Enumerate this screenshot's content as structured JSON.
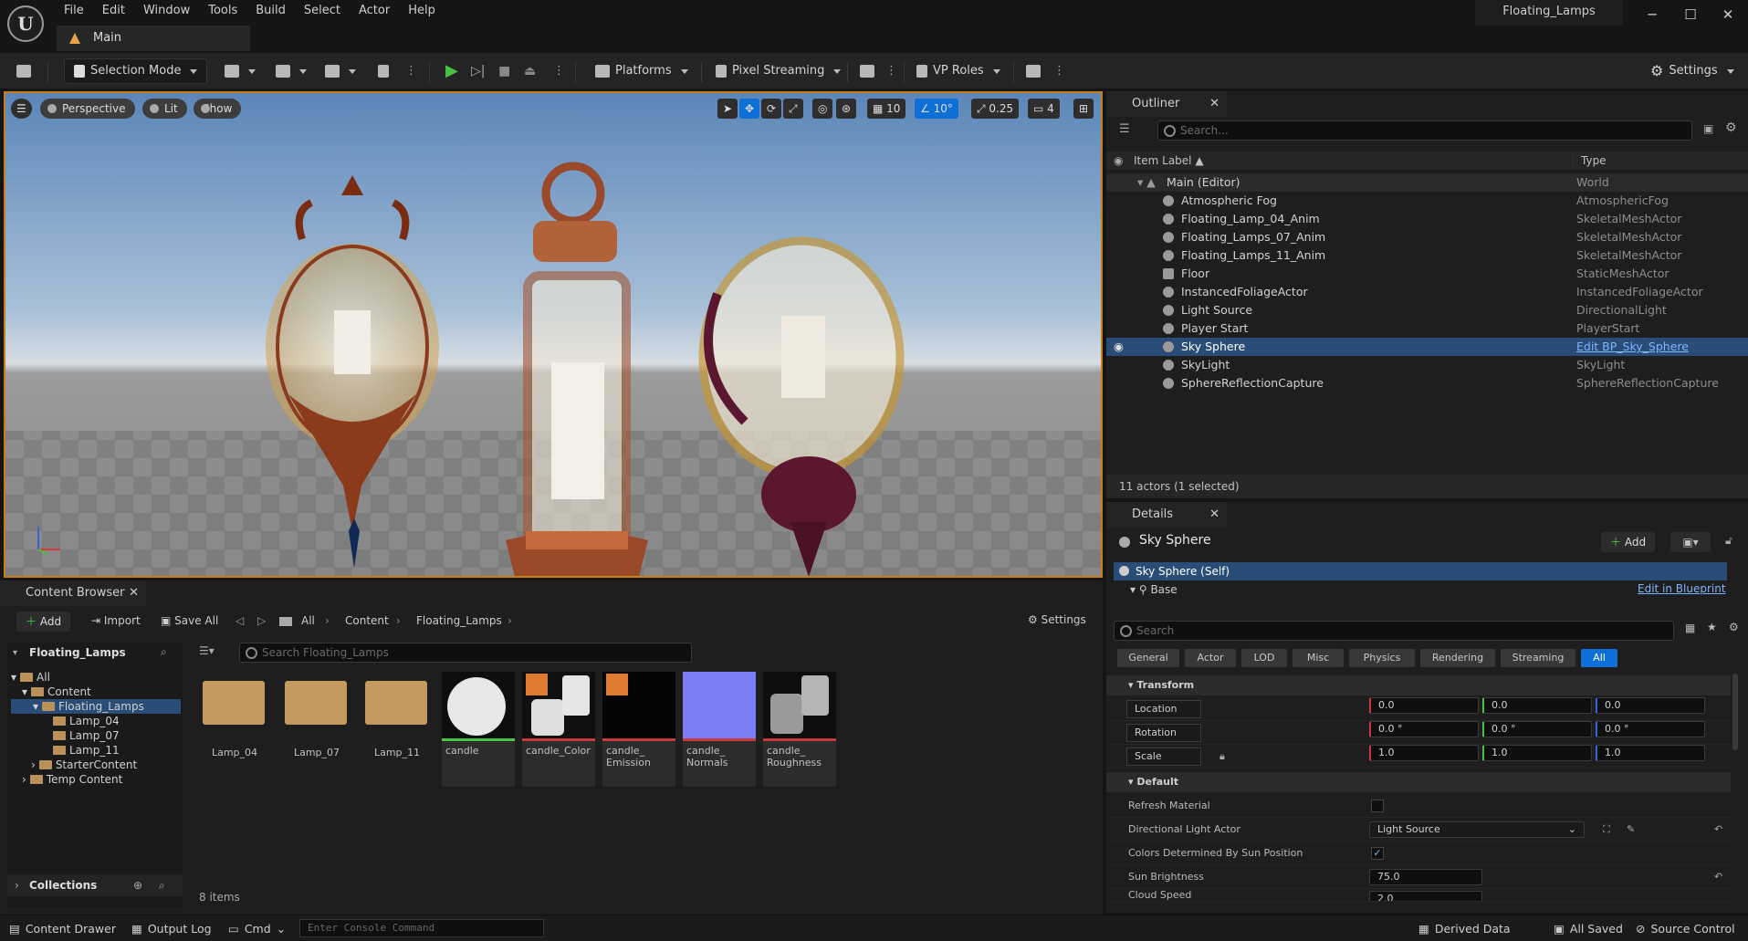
{
  "app": {
    "menus": [
      "File",
      "Edit",
      "Window",
      "Tools",
      "Build",
      "Select",
      "Actor",
      "Help"
    ],
    "project_title": "Floating_Lamps",
    "level_tab": "Main"
  },
  "toolbar": {
    "mode": "Selection Mode",
    "platforms": "Platforms",
    "pixel_streaming": "Pixel Streaming",
    "vp_roles": "VP Roles",
    "settings": "Settings"
  },
  "viewport": {
    "perspective": "Perspective",
    "lit": "Lit",
    "show": "Show",
    "grid_snap": "10",
    "rot_snap": "10°",
    "scale_snap": "0.25",
    "cam_speed": "4"
  },
  "outliner": {
    "tab": "Outliner",
    "search_placeholder": "Search...",
    "col_label": "Item Label ▲",
    "col_type": "Type",
    "items": [
      {
        "label": "Main (Editor)",
        "type": "World"
      },
      {
        "label": "Atmospheric Fog",
        "type": "AtmosphericFog"
      },
      {
        "label": "Floating_Lamp_04_Anim",
        "type": "SkeletalMeshActor"
      },
      {
        "label": "Floating_Lamps_07_Anim",
        "type": "SkeletalMeshActor"
      },
      {
        "label": "Floating_Lamps_11_Anim",
        "type": "SkeletalMeshActor"
      },
      {
        "label": "Floor",
        "type": "StaticMeshActor"
      },
      {
        "label": "InstancedFoliageActor",
        "type": "InstancedFoliageActor"
      },
      {
        "label": "Light Source",
        "type": "DirectionalLight"
      },
      {
        "label": "Player Start",
        "type": "PlayerStart"
      },
      {
        "label": "Sky Sphere",
        "type": "Edit BP_Sky_Sphere"
      },
      {
        "label": "SkyLight",
        "type": "SkyLight"
      },
      {
        "label": "SphereReflectionCapture",
        "type": "SphereReflectionCapture"
      }
    ],
    "footer": "11 actors (1 selected)"
  },
  "details": {
    "tab": "Details",
    "actor_name": "Sky Sphere",
    "add": "Add",
    "self": "Sky Sphere (Self)",
    "base": "Base",
    "edit_bp": "Edit in Blueprint",
    "search_placeholder": "Search",
    "filters": [
      "General",
      "Actor",
      "LOD",
      "Misc",
      "Physics",
      "Rendering",
      "Streaming",
      "All"
    ],
    "transform_section": "Transform",
    "location": "Location",
    "rotation": "Rotation",
    "scale": "Scale",
    "loc_values": [
      "0.0",
      "0.0",
      "0.0"
    ],
    "rot_values": [
      "0.0 °",
      "0.0 °",
      "0.0 °"
    ],
    "scale_values": [
      "1.0",
      "1.0",
      "1.0"
    ],
    "default_section": "Default",
    "refresh_material": "Refresh Material",
    "dir_light_actor": "Directional Light Actor",
    "dir_light_value": "Light Source",
    "colors_by_sun": "Colors Determined By Sun Position",
    "sun_brightness": "Sun Brightness",
    "sun_brightness_value": "75.0",
    "cloud_speed": "Cloud Speed",
    "cloud_speed_value": "2.0"
  },
  "content_browser": {
    "tab": "Content Browser",
    "add": "Add",
    "import": "Import",
    "save_all": "Save All",
    "crumbs": [
      "All",
      "Content",
      "Floating_Lamps"
    ],
    "settings": "Settings",
    "tree_header": "Floating_Lamps",
    "tree": [
      "All",
      "Content",
      "Floating_Lamps",
      "Lamp_04",
      "Lamp_07",
      "Lamp_11",
      "StarterContent",
      "Temp Content"
    ],
    "search_placeholder": "Search Floating_Lamps",
    "assets": [
      {
        "name": "Lamp_04"
      },
      {
        "name": "Lamp_07"
      },
      {
        "name": "Lamp_11"
      },
      {
        "name": "candle"
      },
      {
        "name": "candle_Color"
      },
      {
        "name": "candle_\nEmission"
      },
      {
        "name": "candle_\nNormals"
      },
      {
        "name": "candle_\nRoughness"
      }
    ],
    "count": "8 items",
    "collections": "Collections"
  },
  "statusbar": {
    "content_drawer": "Content Drawer",
    "output_log": "Output Log",
    "cmd": "Cmd",
    "console_placeholder": "Enter Console Command",
    "derived_data": "Derived Data",
    "all_saved": "All Saved",
    "source_control": "Source Control"
  },
  "colors": {
    "accent": "#0e6fd6",
    "selection": "#2a4d78",
    "viewport_border": "#c77d18"
  }
}
